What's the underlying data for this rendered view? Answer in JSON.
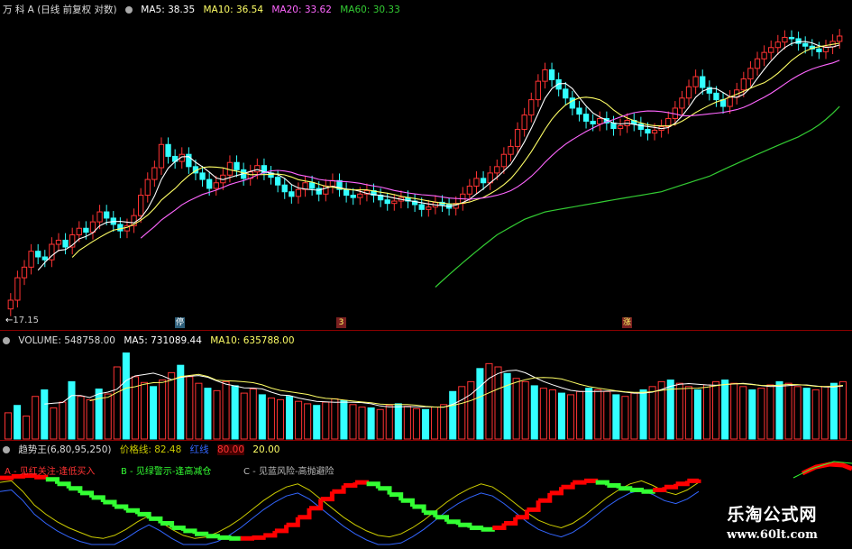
{
  "price_header": {
    "stock_title": "万 科 A (日线 前复权 对数)",
    "ma5": "MA5: 38.35",
    "ma10": "MA10: 36.54",
    "ma20": "MA20: 33.62",
    "ma60": "MA60: 30.33"
  },
  "volume_header": {
    "volume": "VOLUME: 548758.00",
    "ma5": "MA5: 731089.44",
    "ma10": "MA10: 635788.00"
  },
  "indicator_header": {
    "name": "趋势王(6,80,95,250)",
    "price_line": "价格线: 82.48",
    "red_label": "红线",
    "level_80": "80.00",
    "level_20": "20.00"
  },
  "legend": {
    "a": "A - 见红关注-逢低买入",
    "b": "B - 见绿警示-逢高减仓",
    "c": "C - 见蓝风险-高抛避险"
  },
  "low_price_label": "17.15",
  "markers": [
    "停",
    "3",
    "涨"
  ],
  "watermark": {
    "line1": "乐淘公式网",
    "line2": "www.60lt.com"
  },
  "colors": {
    "up": "#ff3333",
    "down": "#33ffff",
    "ma5": "#ffffff",
    "ma10": "#ffff66",
    "ma20": "#ff66ff",
    "ma60": "#33cc33",
    "trend_red": "#ff0000",
    "trend_green": "#33ff33",
    "trend_blue": "#3366ff",
    "price_line": "#cccc00"
  },
  "chart_data": [
    {
      "type": "candlestick",
      "scale": "log",
      "series_ma": [
        "MA5",
        "MA10",
        "MA20",
        "MA60"
      ],
      "close": [
        17.2,
        18.6,
        19.3,
        20.4,
        20.0,
        19.8,
        20.9,
        21.2,
        20.7,
        21.6,
        22.1,
        21.8,
        22.6,
        23.4,
        22.9,
        22.4,
        21.9,
        22.3,
        23.1,
        24.8,
        26.2,
        27.3,
        29.6,
        28.4,
        27.9,
        28.6,
        27.4,
        26.8,
        26.2,
        25.4,
        25.9,
        26.6,
        27.8,
        27.1,
        26.3,
        26.9,
        27.5,
        26.8,
        26.4,
        25.7,
        25.1,
        24.7,
        25.3,
        25.9,
        25.4,
        24.9,
        25.6,
        26.1,
        25.3,
        24.8,
        24.6,
        24.9,
        25.2,
        24.8,
        24.4,
        24.1,
        24.3,
        24.6,
        24.3,
        24.0,
        23.6,
        23.8,
        24.2,
        24.0,
        23.7,
        24.1,
        24.9,
        25.6,
        26.3,
        25.9,
        26.8,
        27.4,
        28.6,
        29.4,
        31.2,
        32.8,
        34.6,
        36.9,
        38.4,
        37.1,
        35.9,
        34.8,
        33.6,
        32.9,
        32.1,
        31.8,
        32.4,
        31.9,
        31.3,
        31.6,
        32.2,
        31.8,
        31.2,
        30.8,
        31.1,
        31.5,
        32.4,
        33.6,
        34.8,
        36.2,
        37.5,
        36.1,
        35.4,
        34.6,
        33.8,
        34.9,
        35.8,
        37.2,
        38.6,
        39.9,
        40.8,
        41.5,
        42.3,
        43.0,
        42.8,
        42.1,
        41.7,
        41.3,
        40.9,
        41.6,
        42.4,
        43.2
      ],
      "ma60": [
        18.0,
        18.4,
        18.8,
        19.2,
        19.6,
        20.0,
        20.4,
        20.8,
        21.2,
        21.6,
        21.9,
        22.2,
        22.5,
        22.8,
        23.0,
        23.2,
        23.4,
        23.5,
        23.6,
        23.7,
        23.8,
        23.9,
        24.0,
        24.1,
        24.2,
        24.3,
        24.4,
        24.5,
        24.6,
        24.7,
        24.8,
        24.9,
        25.0,
        25.1,
        25.3,
        25.5,
        25.7,
        25.9,
        26.1,
        26.3,
        26.5,
        26.8,
        27.1,
        27.4,
        27.7,
        28.0,
        28.3,
        28.6,
        28.9,
        29.2,
        29.5,
        29.8,
        30.1,
        30.4,
        30.8,
        31.2,
        31.7,
        32.3,
        33.0,
        33.8
      ]
    },
    {
      "type": "bar",
      "title": "VOLUME",
      "values": [
        320,
        410,
        280,
        520,
        600,
        380,
        450,
        700,
        520,
        480,
        610,
        550,
        880,
        1050,
        760,
        690,
        640,
        720,
        810,
        900,
        760,
        680,
        620,
        590,
        700,
        650,
        560,
        610,
        540,
        500,
        480,
        520,
        460,
        430,
        410,
        450,
        490,
        470,
        420,
        390,
        380,
        360,
        410,
        430,
        400,
        370,
        360,
        390,
        420,
        580,
        640,
        700,
        860,
        920,
        880,
        800,
        740,
        700,
        650,
        620,
        600,
        560,
        540,
        580,
        620,
        600,
        580,
        540,
        520,
        560,
        600,
        640,
        700,
        720,
        680,
        640,
        600,
        660,
        700,
        720,
        680,
        640,
        600,
        620,
        660,
        700,
        680,
        640,
        620,
        600,
        640,
        680,
        700
      ]
    },
    {
      "type": "line",
      "title": "趋势王(6,80,95,250)",
      "ylim": [
        0,
        100
      ],
      "levels": [
        20,
        80
      ],
      "trend": [
        88,
        90,
        91,
        89,
        86,
        80,
        74,
        68,
        62,
        56,
        50,
        45,
        40,
        34,
        28,
        22,
        18,
        14,
        11,
        9,
        8,
        8,
        9,
        12,
        18,
        26,
        36,
        48,
        60,
        70,
        78,
        82,
        80,
        74,
        66,
        58,
        50,
        42,
        36,
        30,
        26,
        22,
        20,
        22,
        28,
        36,
        46,
        58,
        68,
        76,
        82,
        84,
        82,
        78,
        74,
        72,
        70,
        72,
        76,
        80,
        84,
        86
      ],
      "trend_phase": [
        "red",
        "red",
        "red",
        "red",
        "green",
        "green",
        "green",
        "green",
        "green",
        "green",
        "green",
        "green",
        "green",
        "green",
        "green",
        "green",
        "green",
        "green",
        "green",
        "green",
        "green",
        "red",
        "red",
        "red",
        "red",
        "red",
        "red",
        "red",
        "red",
        "red",
        "red",
        "red",
        "green",
        "green",
        "green",
        "green",
        "green",
        "green",
        "green",
        "green",
        "green",
        "green",
        "green",
        "red",
        "red",
        "red",
        "red",
        "red",
        "red",
        "red",
        "red",
        "red",
        "green",
        "green",
        "green",
        "green",
        "green",
        "red",
        "red",
        "red",
        "red",
        "red"
      ],
      "price_line": [
        82,
        84,
        70,
        52,
        40,
        30,
        22,
        16,
        10,
        8,
        12,
        20,
        30,
        38,
        30,
        20,
        12,
        8,
        10,
        16,
        24,
        34,
        46,
        58,
        68,
        76,
        80,
        72,
        60,
        48,
        36,
        26,
        18,
        12,
        10,
        14,
        22,
        32,
        44,
        56,
        66,
        74,
        80,
        76,
        66,
        54,
        42,
        32,
        26,
        22,
        28,
        38,
        50,
        62,
        72,
        80,
        84,
        78,
        70,
        66,
        72,
        82
      ]
    }
  ]
}
